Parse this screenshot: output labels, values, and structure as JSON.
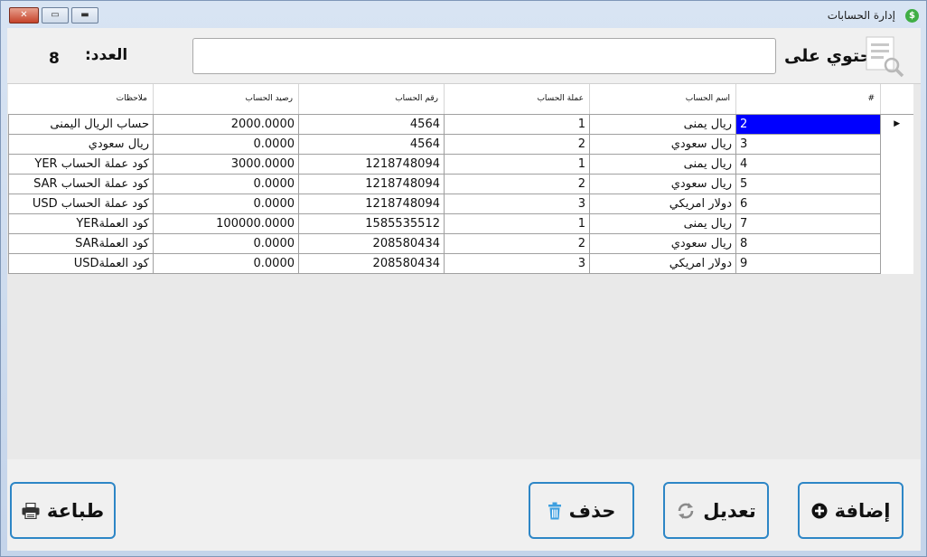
{
  "window": {
    "title": "إدارة الحسابات",
    "icon_letter": "$",
    "controls": {
      "close_icon": "close-icon",
      "maximize_icon": "maximize-icon",
      "minimize_icon": "minimize-icon"
    }
  },
  "header": {
    "count_label": "العدد:",
    "count_value": "8",
    "contains_label": "يحتوي على",
    "search_value": "",
    "search_icon": "search-list-icon"
  },
  "grid": {
    "columns": [
      "#",
      "اسم الحساب",
      "عملة الحساب",
      "رقم الحساب",
      "رصيد الحساب",
      "ملاحظات"
    ],
    "current_row_marker": "▶",
    "rows": [
      {
        "id": "2",
        "name": "ريال يمنى",
        "currency": "1",
        "number": "4564",
        "balance": "2000.0000",
        "notes": "حساب الريال اليمنى"
      },
      {
        "id": "3",
        "name": "ريال سعودي",
        "currency": "2",
        "number": "4564",
        "balance": "0.0000",
        "notes": "ريال سعودي"
      },
      {
        "id": "4",
        "name": "ريال يمنى",
        "currency": "1",
        "number": "1218748094",
        "balance": "3000.0000",
        "notes": "كود عملة الحساب  YER"
      },
      {
        "id": "5",
        "name": "ريال سعودي",
        "currency": "2",
        "number": "1218748094",
        "balance": "0.0000",
        "notes": "كود عملة الحساب  SAR"
      },
      {
        "id": "6",
        "name": "دولار امريكي",
        "currency": "3",
        "number": "1218748094",
        "balance": "0.0000",
        "notes": "كود عملة الحساب  USD"
      },
      {
        "id": "7",
        "name": "ريال يمنى",
        "currency": "1",
        "number": "1585535512",
        "balance": "100000.0000",
        "notes": "كود العملةYER"
      },
      {
        "id": "8",
        "name": "ريال سعودي",
        "currency": "2",
        "number": "208580434",
        "balance": "0.0000",
        "notes": "كود العملةSAR"
      },
      {
        "id": "9",
        "name": "دولار امريكي",
        "currency": "3",
        "number": "208580434",
        "balance": "0.0000",
        "notes": "كود العملةUSD"
      }
    ]
  },
  "buttons": {
    "add": {
      "label": "إضافة",
      "icon": "plus-circle-icon"
    },
    "edit": {
      "label": "تعديل",
      "icon": "refresh-icon"
    },
    "delete": {
      "label": "حذف",
      "icon": "trash-icon"
    },
    "print": {
      "label": "طباعة",
      "icon": "printer-icon"
    }
  },
  "colors": {
    "accent_border": "#2d86c6",
    "selection": "#0000ff",
    "close_button": "#c5432a",
    "app_icon": "#3fae45"
  }
}
